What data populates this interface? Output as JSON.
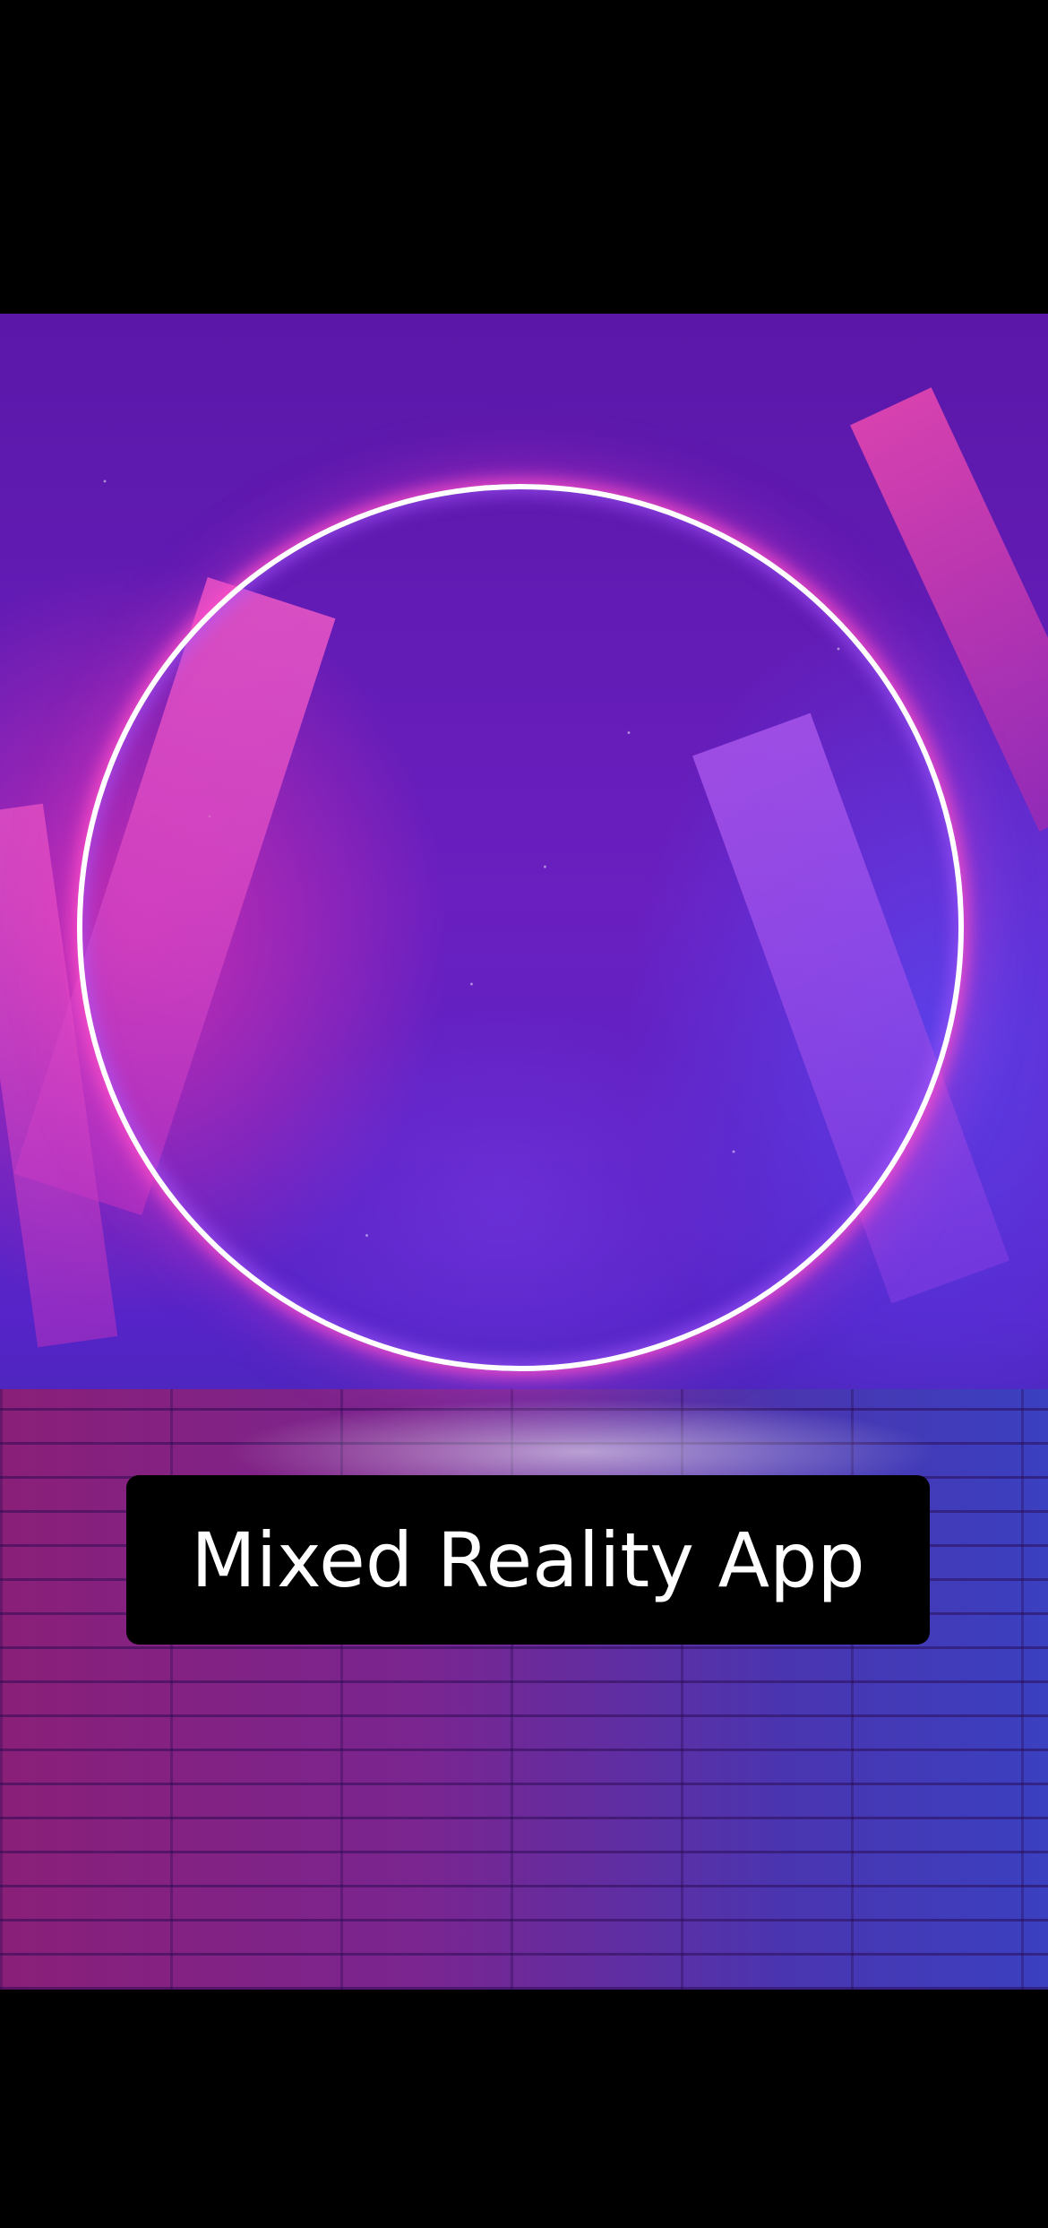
{
  "hero": {
    "image": "neon-ring-crystals-background"
  },
  "cta": {
    "label": "Mixed Reality App"
  },
  "colors": {
    "ring": "#ffffff",
    "button_bg": "#000000",
    "button_text": "#ffffff"
  }
}
